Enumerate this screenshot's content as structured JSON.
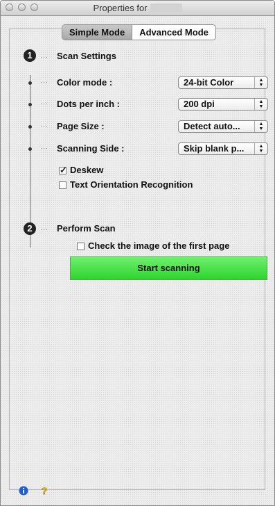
{
  "window": {
    "title": "Properties for"
  },
  "tabs": [
    {
      "label": "Simple Mode",
      "selected": true
    },
    {
      "label": "Advanced Mode",
      "selected": false
    }
  ],
  "step1": {
    "number": "1",
    "title": "Scan Settings",
    "settings": [
      {
        "label": "Color mode :",
        "value": "24-bit Color"
      },
      {
        "label": "Dots per inch :",
        "value": "200 dpi"
      },
      {
        "label": "Page Size :",
        "value": "Detect auto..."
      },
      {
        "label": "Scanning Side :",
        "value": "Skip blank p..."
      }
    ],
    "deskew": {
      "label": "Deskew",
      "checked": true
    },
    "orientation": {
      "label": "Text Orientation Recognition",
      "checked": false
    }
  },
  "step2": {
    "number": "2",
    "title": "Perform Scan",
    "check_first": {
      "label": "Check the image of the first page",
      "checked": false
    },
    "start_button": "Start scanning"
  },
  "footer": {
    "info_icon": "info-icon",
    "help_icon": "help-icon"
  },
  "colors": {
    "start_button": "#3ee03e",
    "info": "#1e5fd8",
    "help": "#e8c21a"
  }
}
